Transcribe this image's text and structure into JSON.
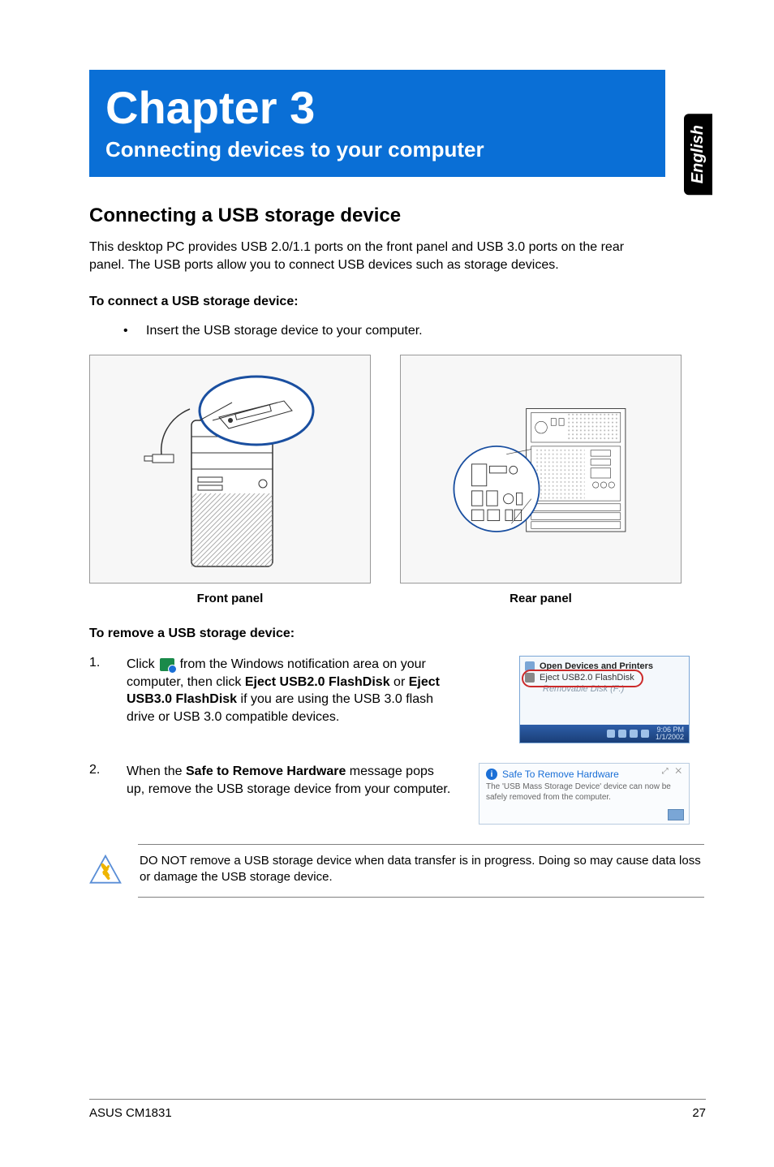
{
  "lang": "English",
  "chapter": {
    "title": "Chapter 3",
    "subtitle": "Connecting devices to your computer"
  },
  "section": {
    "title": "Connecting a USB storage device",
    "intro": "This desktop PC provides USB 2.0/1.1 ports on the front panel and USB 3.0 ports on the rear panel. The USB ports allow you to connect USB devices such as storage devices."
  },
  "connect": {
    "heading": "To connect a USB storage device:",
    "bullet": "Insert the USB storage device to your computer."
  },
  "panels": {
    "front_caption": "Front panel",
    "rear_caption": "Rear panel"
  },
  "remove": {
    "heading": "To remove a USB storage device:",
    "step1_pre": "Click ",
    "step1_mid": " from the Windows notification area on your computer, then click ",
    "step1_bold1": "Eject USB2.0 FlashDisk",
    "step1_or": " or ",
    "step1_bold2": "Eject USB3.0 FlashDisk",
    "step1_post": " if you are using the USB 3.0 flash drive or USB 3.0 compatible devices.",
    "step2_pre": "When the ",
    "step2_bold": "Safe to Remove Hardware",
    "step2_post": " message pops up, remove the USB storage device from your computer."
  },
  "screenshots": {
    "menu_item1": "Open Devices and Printers",
    "menu_item2": "Eject USB2.0 FlashDisk",
    "menu_item3": "Removable Disk (F:)",
    "taskbar_time_top": "9:06 PM",
    "taskbar_time_bottom": "1/1/2002",
    "safe_title": "Safe To Remove Hardware",
    "safe_body": "The 'USB Mass Storage Device' device can now be safely removed from the computer.",
    "safe_close": "✕"
  },
  "caution": "DO NOT remove a USB storage device when data transfer is in progress. Doing so may cause data loss or damage the USB storage device.",
  "footer": {
    "left": "ASUS CM1831",
    "right": "27"
  }
}
